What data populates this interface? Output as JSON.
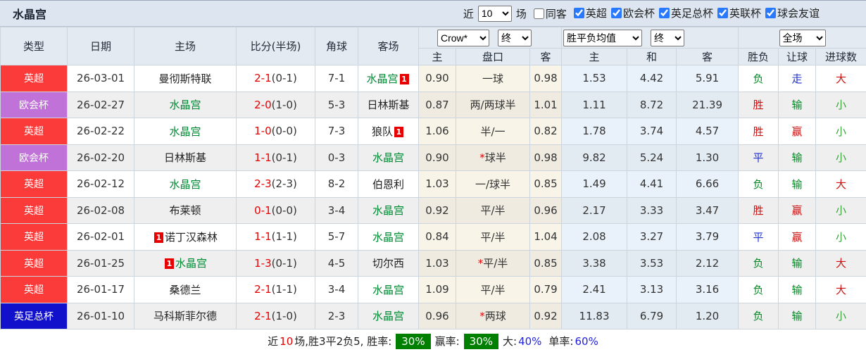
{
  "header": {
    "title": "水晶宫",
    "near_label": "近",
    "games_count": "10",
    "games_suffix": "场",
    "same_away_label": "同客",
    "same_away_checked": false,
    "league_filters": [
      {
        "label": "英超",
        "checked": true
      },
      {
        "label": "欧会杯",
        "checked": true
      },
      {
        "label": "英足总杯",
        "checked": true
      },
      {
        "label": "英联杯",
        "checked": true
      },
      {
        "label": "球会友谊",
        "checked": true
      }
    ]
  },
  "table": {
    "columns": [
      "类型",
      "日期",
      "主场",
      "比分(半场)",
      "角球",
      "客场"
    ],
    "dropdowns": {
      "bookmaker": "Crow*",
      "bookmaker_state": "终",
      "avg": "胜平负均值",
      "avg_state": "终",
      "scope": "全场"
    },
    "sub_columns": [
      "主",
      "盘口",
      "客",
      "主",
      "和",
      "客",
      "胜负",
      "让球",
      "进球数"
    ],
    "rows": [
      {
        "type": "英超",
        "type_color": "red_badge",
        "date": "26-03-01",
        "home": "曼彻斯特联",
        "home_is_cp": false,
        "home_card": "",
        "score": "2-1",
        "half": "(0-1)",
        "corner": "7-1",
        "away": "水晶宫",
        "away_is_cp": true,
        "away_card": "1",
        "crow_home": "0.90",
        "handicap_star": "",
        "handicap": "一球",
        "crow_away": "0.98",
        "avg_home": "1.53",
        "avg_draw": "4.42",
        "avg_away": "5.91",
        "result": "负",
        "result_color": "green",
        "handicap_result": "走",
        "handicap_result_color": "blue",
        "goals": "大",
        "goals_color": "red"
      },
      {
        "type": "欧会杯",
        "type_color": "purple_badge",
        "date": "26-02-27",
        "home": "水晶宫",
        "home_is_cp": true,
        "home_card": "",
        "score": "2-0",
        "half": "(1-0)",
        "corner": "5-3",
        "away": "日林斯基",
        "away_is_cp": false,
        "away_card": "",
        "crow_home": "0.87",
        "handicap_star": "",
        "handicap": "两/两球半",
        "crow_away": "1.01",
        "avg_home": "1.11",
        "avg_draw": "8.72",
        "avg_away": "21.39",
        "result": "胜",
        "result_color": "red",
        "handicap_result": "输",
        "handicap_result_color": "green",
        "goals": "小",
        "goals_color": "lightgreen"
      },
      {
        "type": "英超",
        "type_color": "red_badge",
        "date": "26-02-22",
        "home": "水晶宫",
        "home_is_cp": true,
        "home_card": "",
        "score": "1-0",
        "half": "(0-0)",
        "corner": "7-3",
        "away": "狼队",
        "away_is_cp": false,
        "away_card": "1",
        "crow_home": "1.06",
        "handicap_star": "",
        "handicap": "半/一",
        "crow_away": "0.82",
        "avg_home": "1.78",
        "avg_draw": "3.74",
        "avg_away": "4.57",
        "result": "胜",
        "result_color": "red",
        "handicap_result": "赢",
        "handicap_result_color": "red",
        "goals": "小",
        "goals_color": "lightgreen"
      },
      {
        "type": "欧会杯",
        "type_color": "purple_badge",
        "date": "26-02-20",
        "home": "日林斯基",
        "home_is_cp": false,
        "home_card": "",
        "score": "1-1",
        "half": "(0-1)",
        "corner": "0-3",
        "away": "水晶宫",
        "away_is_cp": true,
        "away_card": "",
        "crow_home": "0.90",
        "handicap_star": "*",
        "handicap": "球半",
        "crow_away": "0.98",
        "avg_home": "9.82",
        "avg_draw": "5.24",
        "avg_away": "1.30",
        "result": "平",
        "result_color": "blue",
        "handicap_result": "输",
        "handicap_result_color": "green",
        "goals": "小",
        "goals_color": "lightgreen"
      },
      {
        "type": "英超",
        "type_color": "red_badge",
        "date": "26-02-12",
        "home": "水晶宫",
        "home_is_cp": true,
        "home_card": "",
        "score": "2-3",
        "half": "(2-3)",
        "corner": "8-2",
        "away": "伯恩利",
        "away_is_cp": false,
        "away_card": "",
        "crow_home": "1.03",
        "handicap_star": "",
        "handicap": "一/球半",
        "crow_away": "0.85",
        "avg_home": "1.49",
        "avg_draw": "4.41",
        "avg_away": "6.66",
        "result": "负",
        "result_color": "green",
        "handicap_result": "输",
        "handicap_result_color": "green",
        "goals": "大",
        "goals_color": "red"
      },
      {
        "type": "英超",
        "type_color": "red_badge",
        "date": "26-02-08",
        "home": "布莱顿",
        "home_is_cp": false,
        "home_card": "",
        "score": "0-1",
        "half": "(0-0)",
        "corner": "3-4",
        "away": "水晶宫",
        "away_is_cp": true,
        "away_card": "",
        "crow_home": "0.92",
        "handicap_star": "",
        "handicap": "平/半",
        "crow_away": "0.96",
        "avg_home": "2.17",
        "avg_draw": "3.33",
        "avg_away": "3.47",
        "result": "胜",
        "result_color": "red",
        "handicap_result": "赢",
        "handicap_result_color": "red",
        "goals": "小",
        "goals_color": "lightgreen"
      },
      {
        "type": "英超",
        "type_color": "red_badge",
        "date": "26-02-01",
        "home": "诺丁汉森林",
        "home_is_cp": false,
        "home_card": "1",
        "score": "1-1",
        "half": "(1-1)",
        "corner": "5-7",
        "away": "水晶宫",
        "away_is_cp": true,
        "away_card": "",
        "crow_home": "0.84",
        "handicap_star": "",
        "handicap": "平/半",
        "crow_away": "1.04",
        "avg_home": "2.08",
        "avg_draw": "3.27",
        "avg_away": "3.79",
        "result": "平",
        "result_color": "blue",
        "handicap_result": "赢",
        "handicap_result_color": "red",
        "goals": "小",
        "goals_color": "lightgreen"
      },
      {
        "type": "英超",
        "type_color": "red_badge",
        "date": "26-01-25",
        "home": "水晶宫",
        "home_is_cp": true,
        "home_card": "1",
        "score": "1-3",
        "half": "(0-1)",
        "corner": "4-5",
        "away": "切尔西",
        "away_is_cp": false,
        "away_card": "",
        "crow_home": "1.03",
        "handicap_star": "*",
        "handicap": "平/半",
        "crow_away": "0.85",
        "avg_home": "3.38",
        "avg_draw": "3.53",
        "avg_away": "2.12",
        "result": "负",
        "result_color": "green",
        "handicap_result": "输",
        "handicap_result_color": "green",
        "goals": "大",
        "goals_color": "red"
      },
      {
        "type": "英超",
        "type_color": "red_badge",
        "date": "26-01-17",
        "home": "桑德兰",
        "home_is_cp": false,
        "home_card": "",
        "score": "2-1",
        "half": "(1-1)",
        "corner": "3-4",
        "away": "水晶宫",
        "away_is_cp": true,
        "away_card": "",
        "crow_home": "1.09",
        "handicap_star": "",
        "handicap": "平/半",
        "crow_away": "0.79",
        "avg_home": "2.41",
        "avg_draw": "3.13",
        "avg_away": "3.16",
        "result": "负",
        "result_color": "green",
        "handicap_result": "输",
        "handicap_result_color": "green",
        "goals": "大",
        "goals_color": "red"
      },
      {
        "type": "英足总杯",
        "type_color": "blue_badge",
        "date": "26-01-10",
        "home": "马科斯菲尔德",
        "home_is_cp": false,
        "home_card": "",
        "score": "2-1",
        "half": "(1-0)",
        "corner": "2-3",
        "away": "水晶宫",
        "away_is_cp": true,
        "away_card": "",
        "crow_home": "0.96",
        "handicap_star": "*",
        "handicap": "两球",
        "crow_away": "0.92",
        "avg_home": "11.83",
        "avg_draw": "6.79",
        "avg_away": "1.20",
        "result": "负",
        "result_color": "green",
        "handicap_result": "输",
        "handicap_result_color": "green",
        "goals": "小",
        "goals_color": "lightgreen"
      }
    ]
  },
  "footer": {
    "prefix": "近",
    "count": "10",
    "summary": "场,胜3平2负5, 胜率:",
    "win_rate": "30%",
    "handicap_win_label": "赢率:",
    "handicap_win_rate": "30%",
    "big_label": "大:",
    "big_rate": "40%",
    "single_label": "单率:",
    "single_rate": "60%"
  },
  "colors": {
    "red_badge": "#fb3a3a",
    "purple_badge": "#c172d8",
    "blue_badge": "#1111cc",
    "green": "#008822",
    "lightgreen": "#3aa03a",
    "red": "#cc1111",
    "blue": "#2233cc",
    "team_green": "#008833",
    "score_red": "#e60000"
  }
}
